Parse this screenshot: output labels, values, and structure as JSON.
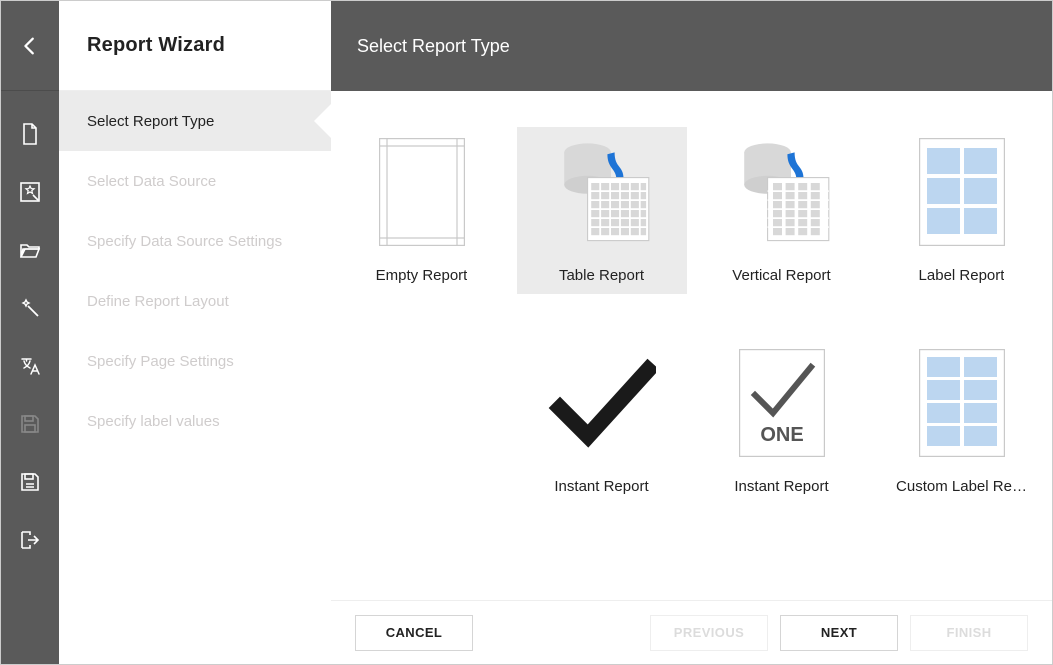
{
  "header": {
    "wizard_title": "Report Wizard",
    "step_title": "Select Report Type"
  },
  "steps": [
    {
      "label": "Select Report Type",
      "active": true
    },
    {
      "label": "Select Data Source",
      "active": false
    },
    {
      "label": "Specify Data Source Settings",
      "active": false
    },
    {
      "label": "Define Report Layout",
      "active": false
    },
    {
      "label": "Specify Page Settings",
      "active": false
    },
    {
      "label": "Specify label values",
      "active": false
    }
  ],
  "types": [
    {
      "label": "Empty Report",
      "kind": "empty",
      "selected": false,
      "borderless": false
    },
    {
      "label": "Table Report",
      "kind": "table",
      "selected": true,
      "borderless": false
    },
    {
      "label": "Vertical Report",
      "kind": "vertical",
      "selected": false,
      "borderless": false
    },
    {
      "label": "Label Report",
      "kind": "label6",
      "selected": false,
      "borderless": false
    },
    {
      "label": "Instant Report",
      "kind": "check",
      "selected": false,
      "borderless": true
    },
    {
      "label": "Instant Report",
      "kind": "checkone",
      "selected": false,
      "borderless": false
    },
    {
      "label": "Custom Label Re…",
      "kind": "label8",
      "selected": false,
      "borderless": false
    }
  ],
  "footer": {
    "cancel": "CANCEL",
    "previous": "PREVIOUS",
    "next": "NEXT",
    "finish": "FINISH",
    "previous_disabled": true,
    "finish_disabled": true
  }
}
